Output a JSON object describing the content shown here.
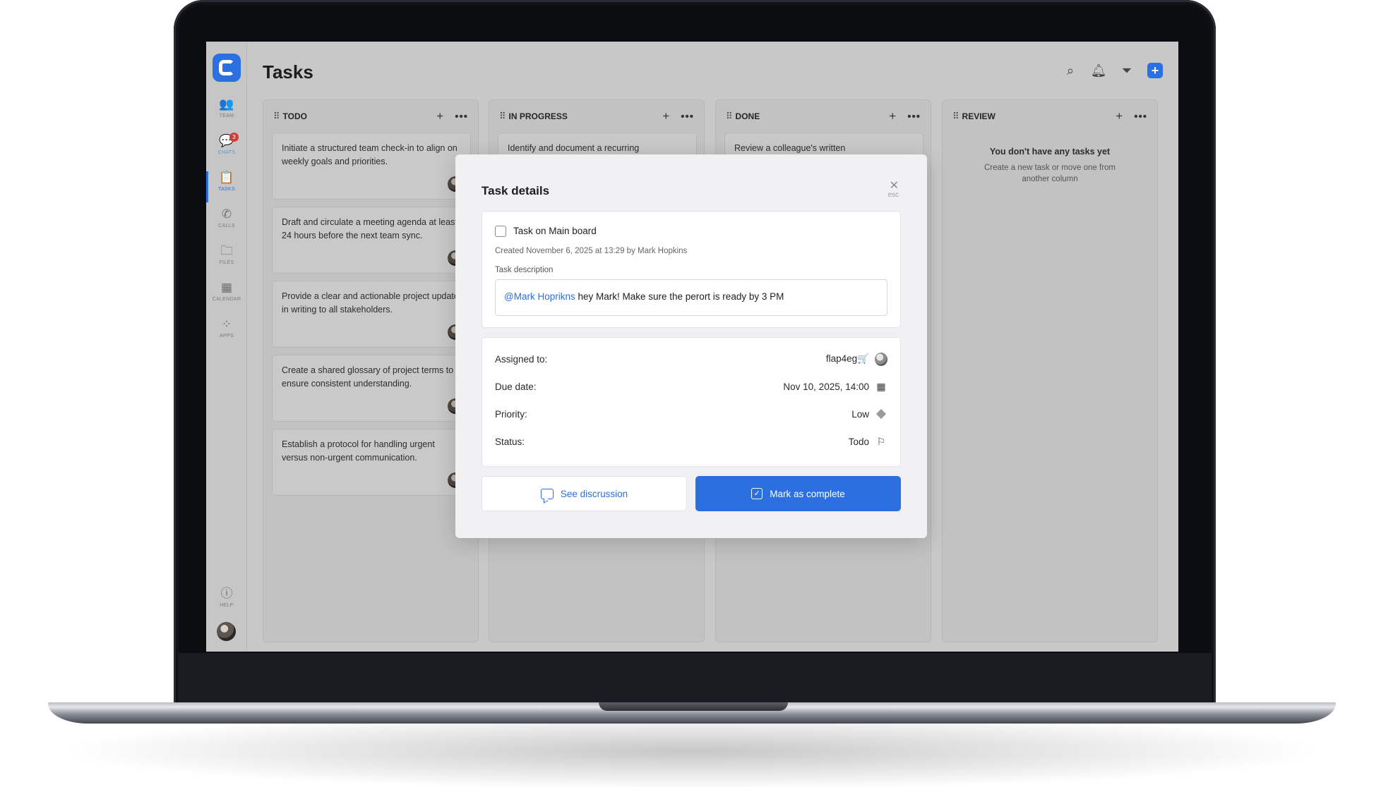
{
  "page": {
    "title": "Tasks"
  },
  "sidebar": {
    "items": [
      {
        "label": "TEAM",
        "icon": "team-icon"
      },
      {
        "label": "CHATS",
        "icon": "chat-icon",
        "badge": "3"
      },
      {
        "label": "TASKS",
        "icon": "tasks-icon"
      },
      {
        "label": "CALLS",
        "icon": "phone-icon"
      },
      {
        "label": "FILES",
        "icon": "folder-icon"
      },
      {
        "label": "CALENDAR",
        "icon": "calendar-icon"
      },
      {
        "label": "APPS",
        "icon": "apps-icon"
      }
    ],
    "help_label": "HELP"
  },
  "columns": [
    {
      "title": "TODO",
      "cards": [
        "Initiate a structured team check-in to align on weekly goals and priorities.",
        "Draft and circulate a meeting agenda at least 24 hours before the next team sync.",
        "Provide a clear and actionable project update in writing to all stakeholders.",
        "Create a shared glossary of project terms to ensure consistent understanding.",
        "Establish a protocol for handling urgent versus non-urgent communication."
      ]
    },
    {
      "title": "IN PROGRESS",
      "cards": [
        "Identify and document a recurring"
      ]
    },
    {
      "title": "DONE",
      "cards": [
        "Review a colleague's written"
      ]
    },
    {
      "title": "REVIEW",
      "cards": [],
      "empty_title": "You don't have any tasks yet",
      "empty_sub": "Create a new task or move one from another column"
    }
  ],
  "modal": {
    "title": "Task details",
    "close_hint": "esc",
    "task_title": "Task on Main board",
    "created": "Created November 6, 2025 at 13:29 by Mark Hopkins",
    "description_label": "Task description",
    "description_mention": "@Mark Hoprikns",
    "description_text": " hey Mark! Make sure the perort is ready by 3 PM",
    "fields": {
      "assigned_label": "Assigned to:",
      "assigned_value": "flap4eg🛒",
      "due_label": "Due date:",
      "due_value": "Nov 10, 2025, 14:00",
      "priority_label": "Priority:",
      "priority_value": "Low",
      "status_label": "Status:",
      "status_value": "Todo"
    },
    "buttons": {
      "discussion": "See discrussion",
      "complete": "Mark as complete"
    }
  },
  "colors": {
    "accent": "#2b6fe0",
    "badge": "#d23b3b"
  }
}
